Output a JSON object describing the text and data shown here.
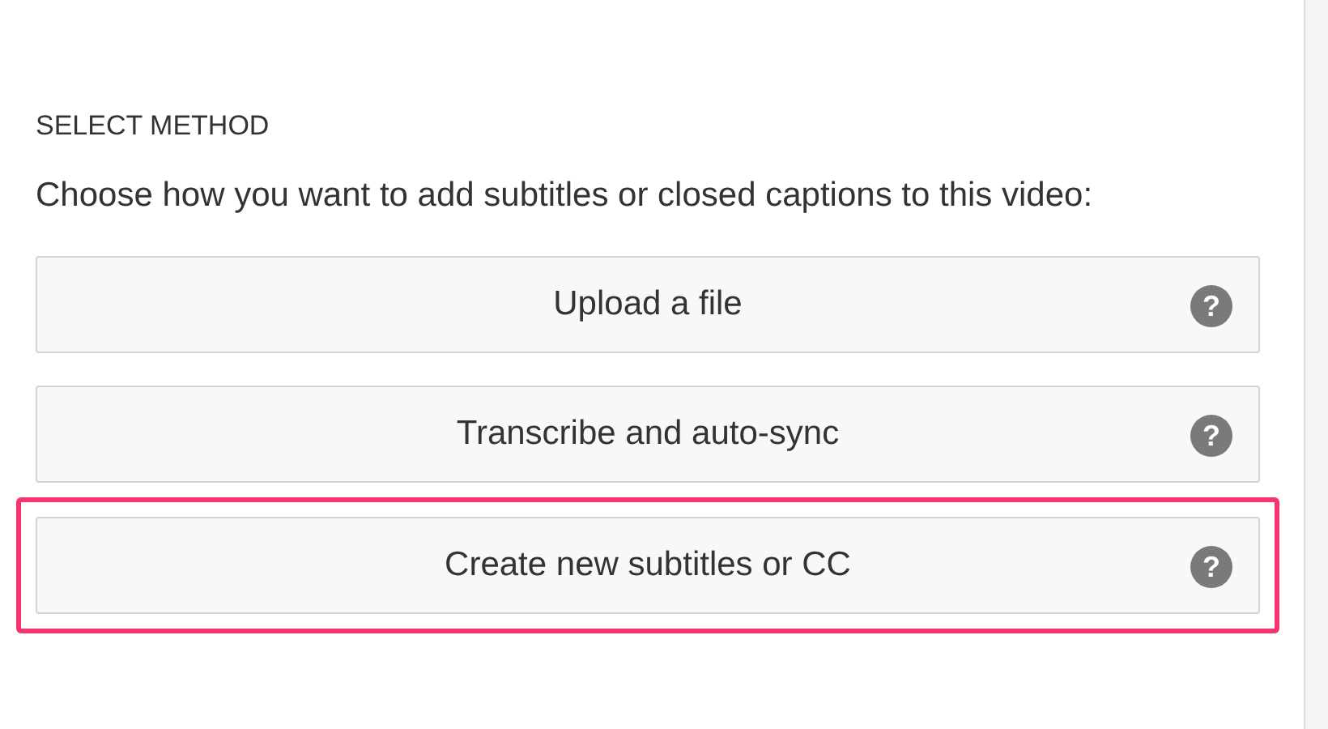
{
  "heading": "SELECT METHOD",
  "description": "Choose how you want to add subtitles or closed captions to this video:",
  "methods": [
    {
      "label": "Upload a file",
      "help": "?",
      "highlighted": false
    },
    {
      "label": "Transcribe and auto-sync",
      "help": "?",
      "highlighted": false
    },
    {
      "label": "Create new subtitles or CC",
      "help": "?",
      "highlighted": true
    }
  ]
}
